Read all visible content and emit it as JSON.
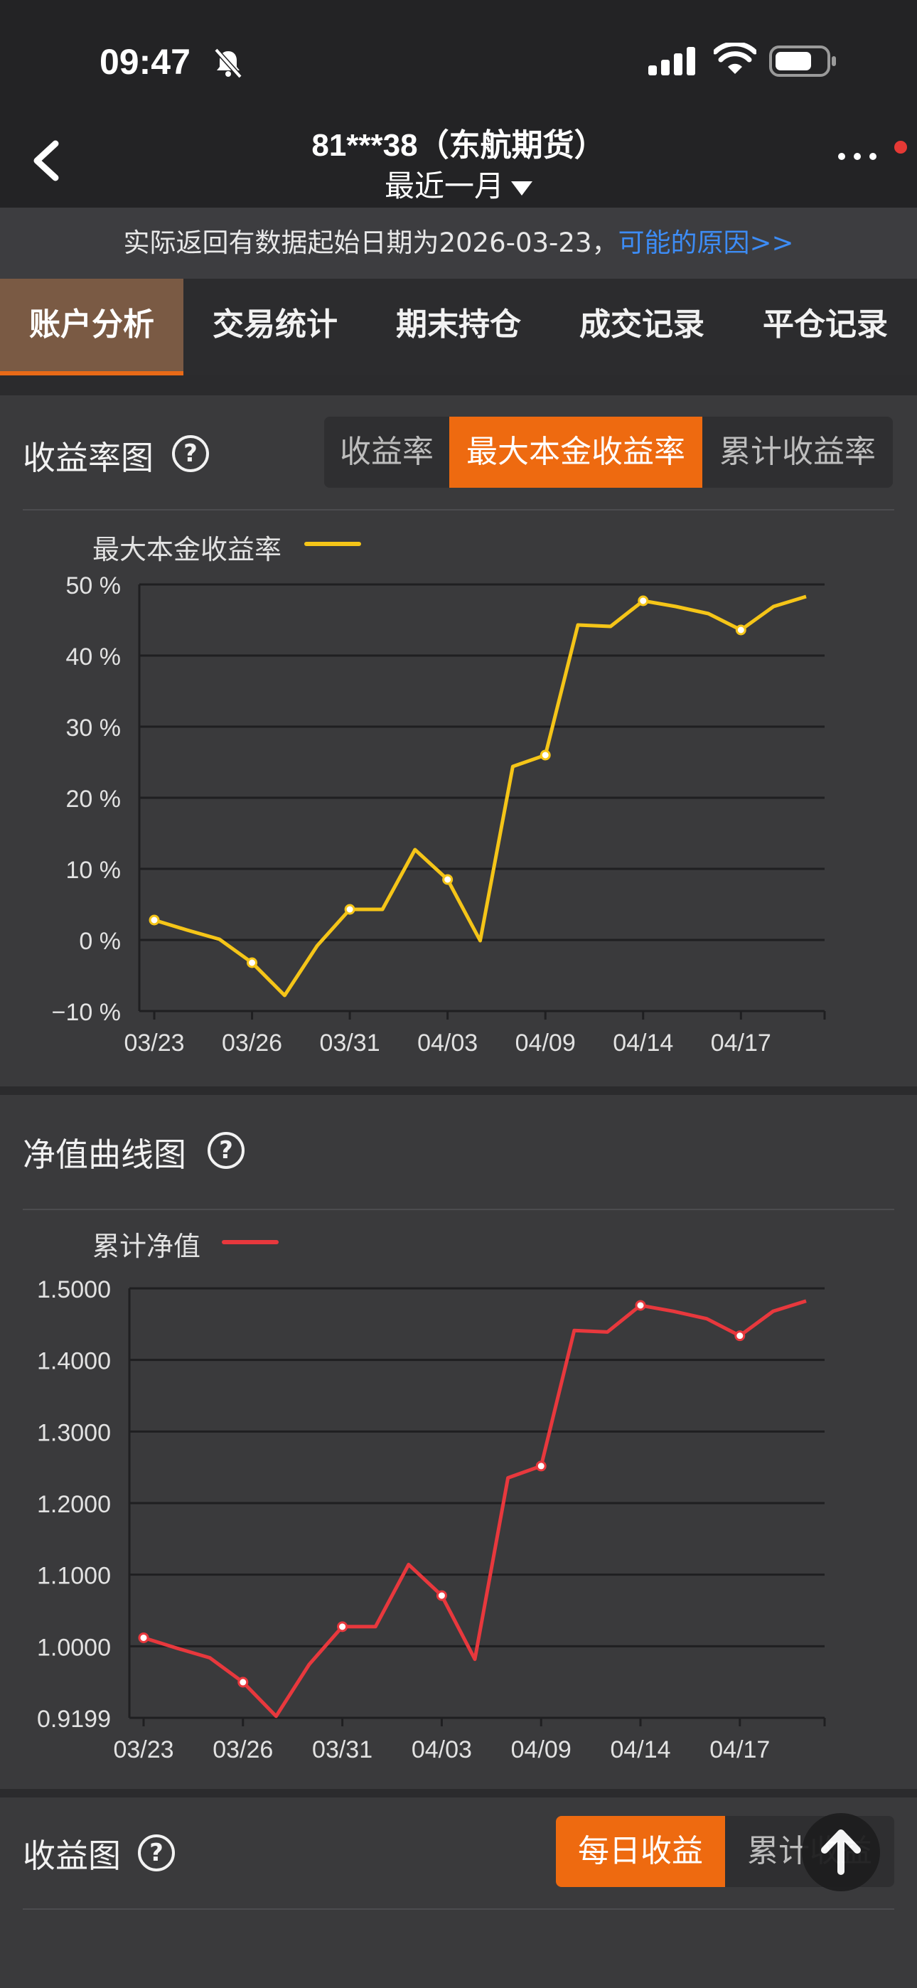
{
  "status": {
    "time": "09:47"
  },
  "header": {
    "title": "81***38（东航期货）",
    "period": "最近一月"
  },
  "notice": {
    "text": "实际返回有数据起始日期为2026-03-23，",
    "link": "可能的原因>>"
  },
  "tabs": [
    "账户分析",
    "交易统计",
    "期末持仓",
    "成交记录",
    "平仓记录"
  ],
  "section_return": {
    "title": "收益率图",
    "segments": [
      "收益率",
      "最大本金收益率",
      "累计收益率"
    ],
    "active_segment": 1,
    "legend": "最大本金收益率"
  },
  "section_nav": {
    "title": "净值曲线图",
    "legend": "累计净值"
  },
  "section_profit": {
    "title": "收益图",
    "segments": [
      "每日收益",
      "累计收益"
    ],
    "active_segment": 0
  },
  "colors": {
    "accent": "#ee6a10",
    "return_line": "#f5c518",
    "nav_line": "#e8383d"
  },
  "chart_data": [
    {
      "type": "line",
      "title": "收益率图",
      "series": [
        {
          "name": "最大本金收益率",
          "values": [
            2.8,
            1.4,
            0.1,
            -3.2,
            -7.8,
            -0.8,
            4.3,
            4.3,
            12.7,
            8.5,
            -0.1,
            24.4,
            26.0,
            44.3,
            44.1,
            47.7,
            46.9,
            45.9,
            43.6,
            46.9,
            48.3
          ]
        }
      ],
      "markers": [
        0,
        3,
        6,
        9,
        12,
        15,
        18
      ],
      "xticks": [
        "03/23",
        "03/26",
        "03/31",
        "04/03",
        "04/09",
        "04/14",
        "04/17"
      ],
      "xtick_positions": [
        0,
        3,
        6,
        9,
        12,
        15,
        18
      ],
      "yticks": [
        "50 %",
        "40 %",
        "30 %",
        "20 %",
        "10 %",
        "0 %",
        "−10 %"
      ],
      "ylim": [
        -10,
        50
      ],
      "grid": true,
      "legend": "top-left"
    },
    {
      "type": "line",
      "title": "净值曲线图",
      "series": [
        {
          "name": "累计净值",
          "values": [
            1.028,
            1.014,
            1.001,
            0.968,
            0.922,
            0.992,
            1.043,
            1.043,
            1.127,
            1.085,
            0.999,
            1.244,
            1.26,
            1.443,
            1.441,
            1.477,
            1.469,
            1.459,
            1.436,
            1.469,
            1.483
          ]
        }
      ],
      "markers": [
        0,
        3,
        6,
        9,
        12,
        15,
        18
      ],
      "xticks": [
        "03/23",
        "03/26",
        "03/31",
        "04/03",
        "04/09",
        "04/14",
        "04/17"
      ],
      "xtick_positions": [
        0,
        3,
        6,
        9,
        12,
        15,
        18
      ],
      "yticks": [
        "1.5000",
        "1.4000",
        "1.3000",
        "1.2000",
        "1.1000",
        "1.0000",
        "0.9199"
      ],
      "ylim": [
        0.9199,
        1.5
      ],
      "grid": true,
      "legend": "top-left"
    }
  ]
}
